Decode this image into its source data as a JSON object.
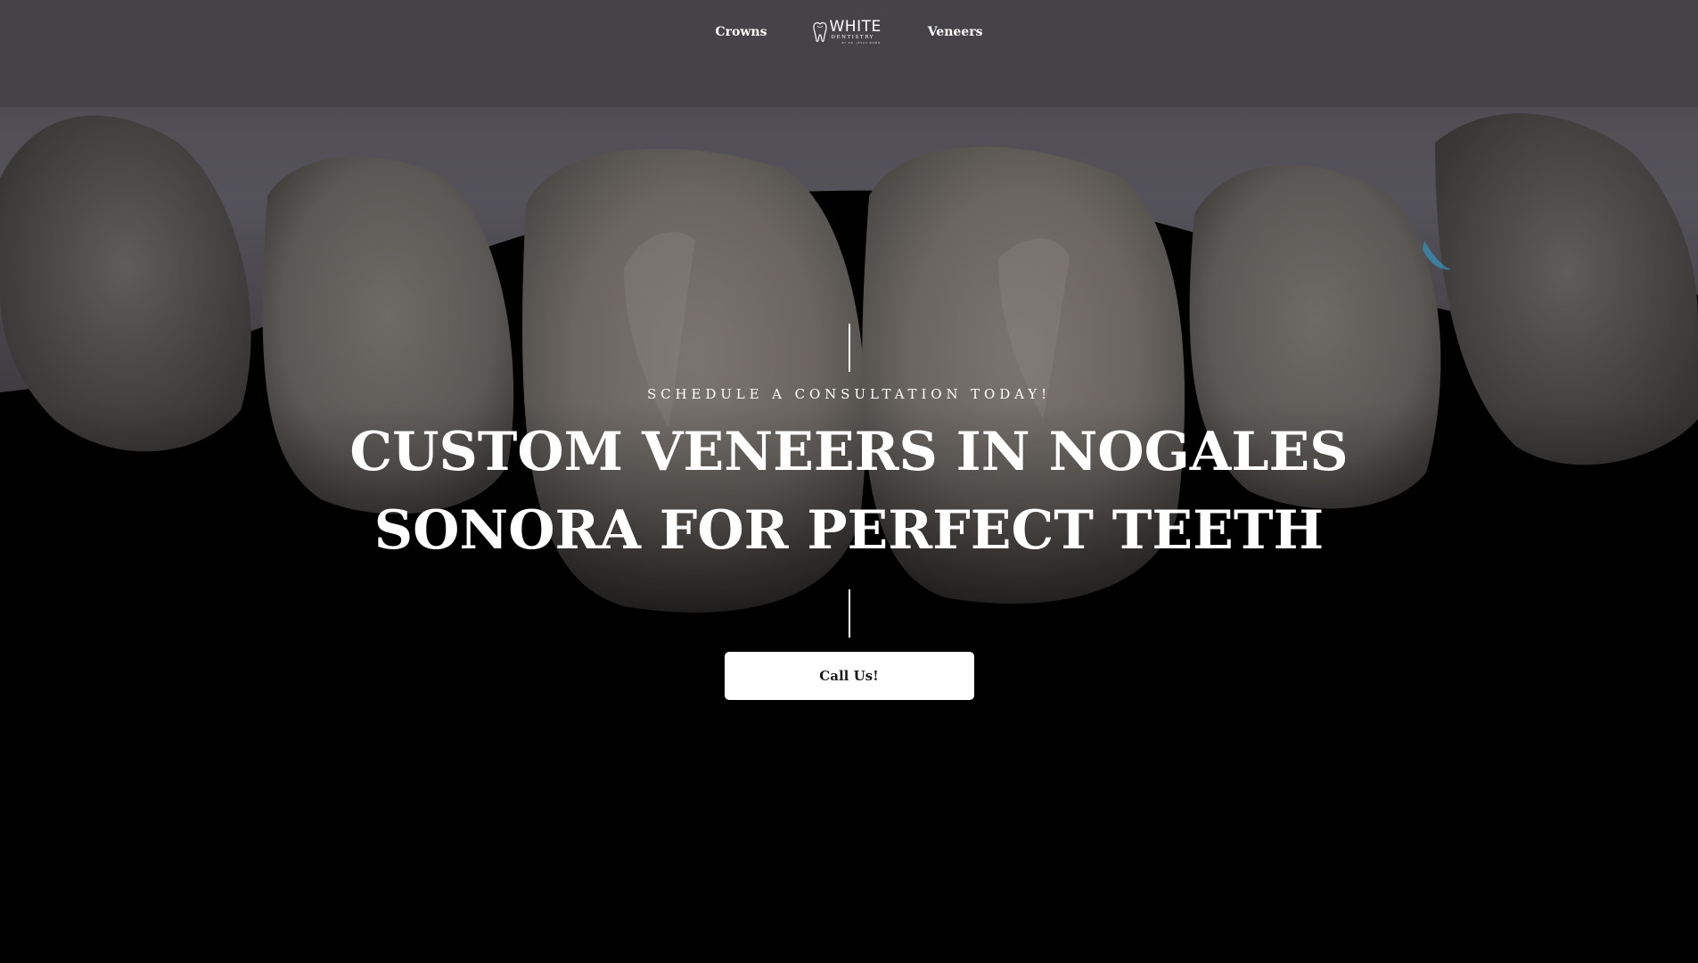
{
  "nav": {
    "left_link": "Crowns",
    "right_link": "Veneers",
    "logo": {
      "word": "WHITE",
      "subtitle": "DENTISTRY",
      "tagline": "BY DR. JESUS ROMO"
    }
  },
  "hero": {
    "eyebrow": "SCHEDULE A CONSULTATION TODAY!",
    "headline": "CUSTOM VENEERS IN NOGALES SONORA FOR PERFECT TEETH",
    "cta_label": "Call Us!"
  },
  "colors": {
    "background": "#000000",
    "text": "#ffffff",
    "button_bg": "#ffffff",
    "button_text": "#1a1a1a",
    "accent_blue": "#2fa7d8"
  },
  "icons": {
    "logo_mark": "tooth-icon"
  }
}
